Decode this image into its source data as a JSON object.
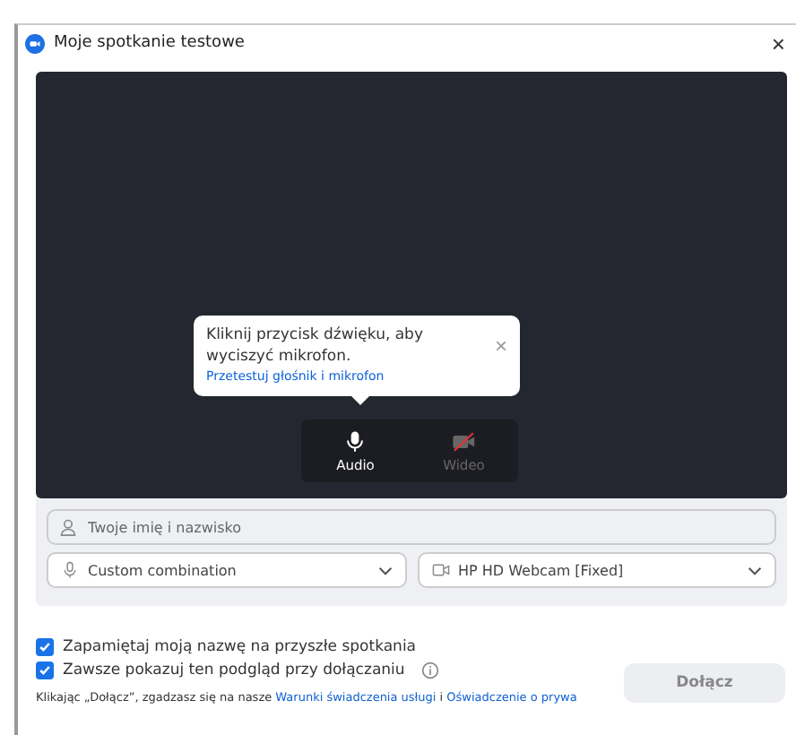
{
  "window": {
    "title": "Moje spotkanie testowe",
    "close": "×"
  },
  "tooltip": {
    "text": "Kliknij przycisk dźwięku, aby wyciszyć mikrofon.",
    "link": "Przetestuj głośnik i mikrofon",
    "close": "×"
  },
  "controls": [
    {
      "kind": "audio",
      "label": "Audio",
      "on": true
    },
    {
      "kind": "video",
      "label": "Wideo",
      "on": false
    }
  ],
  "name_field": {
    "placeholder": "Twoje imię i nazwisko"
  },
  "audio_select": {
    "value": "Custom combination"
  },
  "video_select": {
    "value": "HP HD Webcam [Fixed]"
  },
  "options": [
    {
      "label": "Zapamiętaj moją nazwę na przyszłe spotkania",
      "checked": true,
      "info": false
    },
    {
      "label": "Zawsze pokazuj ten podgląd przy dołączaniu",
      "checked": true,
      "info": true
    }
  ],
  "footer": {
    "text": "Klikając „Dołącz”, zgadzasz się na nasze ",
    "link1": "Warunki świadczenia usługi",
    "mid": " i ",
    "link2": "Oświadczenie o prywa"
  },
  "join_button": {
    "label": "Dołącz",
    "disabled": true
  }
}
